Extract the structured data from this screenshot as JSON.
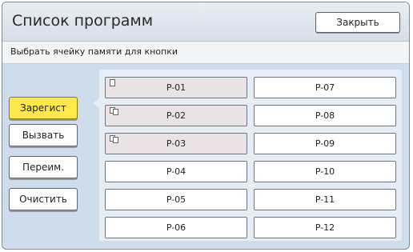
{
  "window": {
    "title": "Список программ",
    "close_label": "Закрыть"
  },
  "instruction": "Выбрать ячейку памяти для кнопки",
  "side_buttons": [
    {
      "label": "Зарегист",
      "active": true
    },
    {
      "label": "Вызвать",
      "active": false
    },
    {
      "label": "Переим.",
      "active": false
    },
    {
      "label": "Очистить",
      "active": false
    }
  ],
  "cells": [
    {
      "label": "P-01",
      "has_data": true
    },
    {
      "label": "P-02",
      "has_data": true
    },
    {
      "label": "P-03",
      "has_data": true
    },
    {
      "label": "P-04",
      "has_data": false
    },
    {
      "label": "P-05",
      "has_data": false
    },
    {
      "label": "P-06",
      "has_data": false
    },
    {
      "label": "P-07",
      "has_data": false
    },
    {
      "label": "P-08",
      "has_data": false
    },
    {
      "label": "P-09",
      "has_data": false
    },
    {
      "label": "P-10",
      "has_data": false
    },
    {
      "label": "P-11",
      "has_data": false
    },
    {
      "label": "P-12",
      "has_data": false
    }
  ],
  "colors": {
    "accent_active": "#ffe84a",
    "panel": "#cfdceb",
    "filled_cell": "#e9e3e6"
  }
}
